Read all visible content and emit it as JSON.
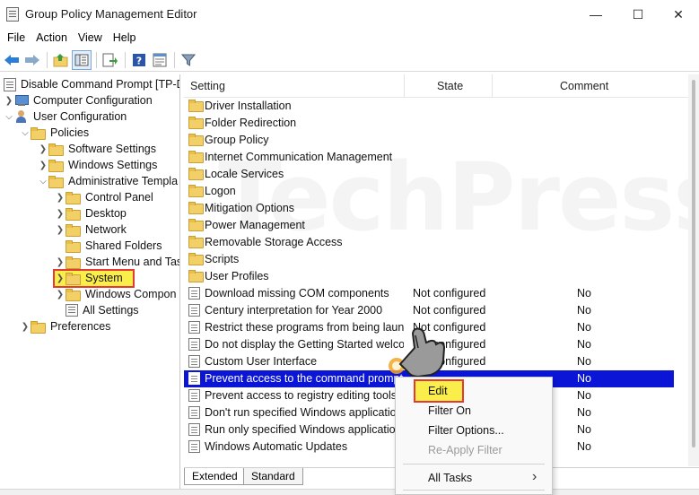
{
  "window": {
    "title": "Group Policy Management Editor",
    "controls": {
      "minimize": "—",
      "maximize": "☐",
      "close": "✕"
    }
  },
  "menu": [
    "File",
    "Action",
    "View",
    "Help"
  ],
  "toolbar": {
    "icons": [
      "back-icon",
      "forward-icon",
      "up-folder-icon",
      "show-hide-tree-icon",
      "export-list-icon",
      "help-icon",
      "properties-icon",
      "filter-icon"
    ]
  },
  "tree": {
    "root": "Disable Command Prompt [TP-D",
    "computer_configuration": "Computer Configuration",
    "user_configuration": "User Configuration",
    "policies": "Policies",
    "software_settings": "Software Settings",
    "windows_settings": "Windows Settings",
    "administrative_templates": "Administrative Templa",
    "control_panel": "Control Panel",
    "desktop": "Desktop",
    "network": "Network",
    "shared_folders": "Shared Folders",
    "start_menu": "Start Menu and Tas",
    "system": "System",
    "windows_components": "Windows Compon",
    "all_settings": "All Settings",
    "preferences": "Preferences"
  },
  "list": {
    "headers": {
      "setting": "Setting",
      "state": "State",
      "comment": "Comment"
    },
    "folders": [
      "Driver Installation",
      "Folder Redirection",
      "Group Policy",
      "Internet Communication Management",
      "Locale Services",
      "Logon",
      "Mitigation Options",
      "Power Management",
      "Removable Storage Access",
      "Scripts",
      "User Profiles"
    ],
    "settings": [
      {
        "name": "Download missing COM components",
        "state": "Not configured",
        "comment": "No"
      },
      {
        "name": "Century interpretation for Year 2000",
        "state": "Not configured",
        "comment": "No"
      },
      {
        "name": "Restrict these programs from being laun...",
        "state": "Not configured",
        "comment": "No"
      },
      {
        "name": "Do not display the Getting Started welco...",
        "state": "Not configured",
        "comment": "No"
      },
      {
        "name": "Custom User Interface",
        "state": "Not configured",
        "comment": "No"
      },
      {
        "name": "Prevent access to the command prompt",
        "state": "",
        "comment": "No"
      },
      {
        "name": "Prevent access to registry editing tools",
        "state": "",
        "comment": "No"
      },
      {
        "name": "Don't run specified Windows applications",
        "state": "",
        "comment": "No"
      },
      {
        "name": "Run only specified Windows applications",
        "state": "",
        "comment": "No"
      },
      {
        "name": "Windows Automatic Updates",
        "state": "",
        "comment": "No"
      }
    ]
  },
  "tabs": {
    "extended": "Extended",
    "standard": "Standard"
  },
  "context_menu": {
    "edit": "Edit",
    "filter_on": "Filter On",
    "filter_options": "Filter Options...",
    "reapply_filter": "Re-Apply Filter",
    "all_tasks": "All Tasks",
    "submenu_arrow": "›"
  },
  "watermark": "TechPress.net",
  "colors": {
    "selection": "#0a15d6",
    "highlight": "#f9ee4a",
    "highlight_border": "#e53935"
  }
}
